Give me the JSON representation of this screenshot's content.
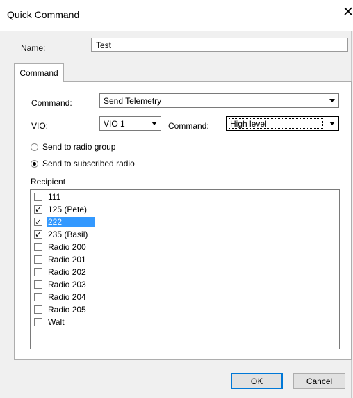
{
  "window": {
    "title": "Quick Command",
    "close_glyph": "✕"
  },
  "name": {
    "label": "Name:",
    "value": "Test"
  },
  "tabs": [
    {
      "label": "Command",
      "selected": true
    }
  ],
  "command_panel": {
    "command_label": "Command:",
    "command_value": "Send Telemetry",
    "vio_label": "VIO:",
    "vio_value": "VIO 1",
    "subcommand_label": "Command:",
    "subcommand_value": "High level",
    "radio_group": {
      "label": "Send to radio group",
      "checked": false
    },
    "radio_subscribed": {
      "label": "Send to subscribed radio",
      "checked": true
    },
    "recipient_label": "Recipient",
    "recipients": [
      {
        "label": "111",
        "checked": false,
        "selected": false
      },
      {
        "label": "125 (Pete)",
        "checked": true,
        "selected": false
      },
      {
        "label": "222",
        "checked": true,
        "selected": true
      },
      {
        "label": "235 (Basil)",
        "checked": true,
        "selected": false
      },
      {
        "label": "Radio 200",
        "checked": false,
        "selected": false
      },
      {
        "label": "Radio 201",
        "checked": false,
        "selected": false
      },
      {
        "label": "Radio 202",
        "checked": false,
        "selected": false
      },
      {
        "label": "Radio 203",
        "checked": false,
        "selected": false
      },
      {
        "label": "Radio 204",
        "checked": false,
        "selected": false
      },
      {
        "label": "Radio 205",
        "checked": false,
        "selected": false
      },
      {
        "label": "Walt",
        "checked": false,
        "selected": false
      }
    ]
  },
  "buttons": {
    "ok": "OK",
    "cancel": "Cancel"
  },
  "colors": {
    "selection": "#3399ff",
    "default_button_border": "#0078d7",
    "dialog_bg": "#f0f0f0"
  }
}
